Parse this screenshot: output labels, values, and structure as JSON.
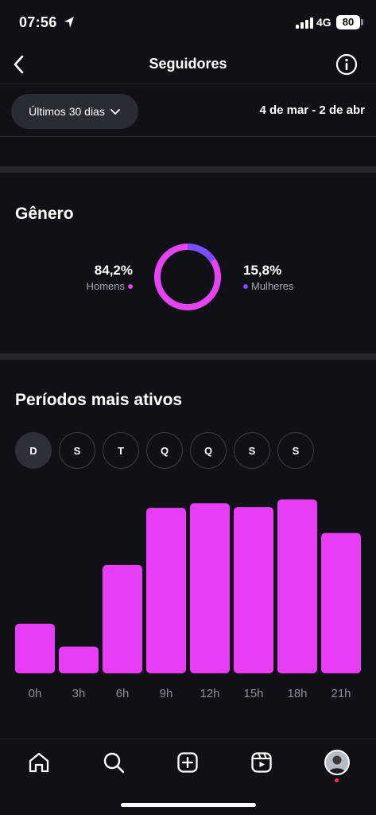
{
  "status": {
    "time": "07:56",
    "network": "4G",
    "battery": "80"
  },
  "nav": {
    "title": "Seguidores"
  },
  "filter": {
    "period": "Últimos 30 dias",
    "date_range": "4 de mar - 2 de abr"
  },
  "gender": {
    "title": "Gênero",
    "men": {
      "percent": "84,2%",
      "label": "Homens",
      "value": 84.2
    },
    "women": {
      "percent": "15,8%",
      "label": "Mulheres",
      "value": 15.8
    }
  },
  "active": {
    "title": "Períodos mais ativos",
    "days": [
      "D",
      "S",
      "T",
      "Q",
      "Q",
      "S",
      "S"
    ],
    "selected_day": 0
  },
  "colors": {
    "men": "#e545f0",
    "women": "#7b4dff",
    "bar": "#e83cf6",
    "background": "#0f1116"
  },
  "icons": {
    "back": "chevron-left-icon",
    "info": "info-icon",
    "dropdown": "chevron-down-icon",
    "tabs": [
      "home-icon",
      "search-icon",
      "create-icon",
      "reels-icon",
      "profile-avatar"
    ]
  },
  "chart_data": {
    "type": "bar",
    "categories": [
      "0h",
      "3h",
      "6h",
      "9h",
      "12h",
      "15h",
      "18h",
      "21h"
    ],
    "values": [
      65,
      35,
      142,
      217,
      223,
      218,
      228,
      184
    ],
    "ylim": [
      0,
      240
    ],
    "grid": false,
    "xlabel": "",
    "ylabel": ""
  }
}
